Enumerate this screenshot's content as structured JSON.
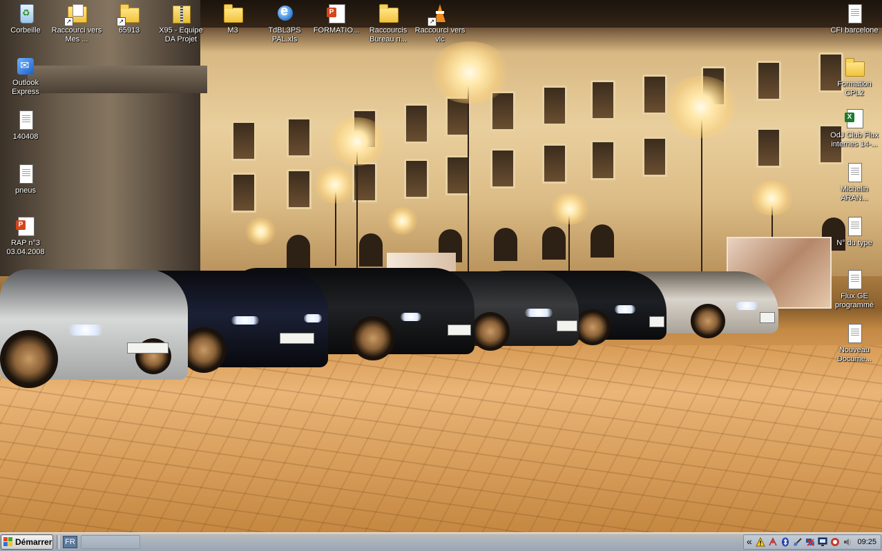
{
  "desktop": {
    "icons_left": [
      {
        "label": "Corbeille",
        "icon": "recycle-bin-icon"
      },
      {
        "label": "Outlook Express",
        "icon": "outlook-express-icon"
      },
      {
        "label": "140408",
        "icon": "text-document-icon"
      },
      {
        "label": "pneus",
        "icon": "text-document-icon"
      },
      {
        "label": "RAP n°3 03.04.2008",
        "icon": "powerpoint-file-icon"
      }
    ],
    "icons_top": [
      {
        "label": "Raccourci vers Mes ...",
        "icon": "my-documents-shortcut-icon"
      },
      {
        "label": "65913",
        "icon": "folder-shortcut-icon"
      },
      {
        "label": "X95 - Equipe DA Projet",
        "icon": "zip-folder-icon"
      },
      {
        "label": "M3",
        "icon": "folder-icon"
      },
      {
        "label": "TdBL3PS PAL.xls",
        "icon": "internet-explorer-icon"
      },
      {
        "label": "FORMATIO...",
        "icon": "powerpoint-file-icon"
      },
      {
        "label": "Raccourcis Bureau n...",
        "icon": "folder-icon"
      },
      {
        "label": "Raccourci vers vlc",
        "icon": "vlc-shortcut-icon"
      }
    ],
    "icons_right": [
      {
        "label": "CFI barcelone",
        "icon": "text-document-icon"
      },
      {
        "label": "Formation CPL2",
        "icon": "folder-icon"
      },
      {
        "label": "OdJ Club Flux internes 14-...",
        "icon": "excel-file-icon"
      },
      {
        "label": "Michelin ARAN...",
        "icon": "text-document-icon"
      },
      {
        "label": "N° du type",
        "icon": "text-document-icon"
      },
      {
        "label": "Flux GE programmé",
        "icon": "text-document-icon"
      },
      {
        "label": "Nouveau Docume...",
        "icon": "text-document-icon"
      }
    ]
  },
  "taskbar": {
    "start_label": "Démarrer",
    "language": "FR",
    "tray_chevron": "«",
    "clock": "09:25",
    "tray_icons": [
      "warning-icon",
      "network-icon",
      "bluetooth-icon",
      "security-icon",
      "disconnected-network-icon",
      "monitor-icon",
      "antivirus-icon",
      "speaker-icon"
    ]
  }
}
